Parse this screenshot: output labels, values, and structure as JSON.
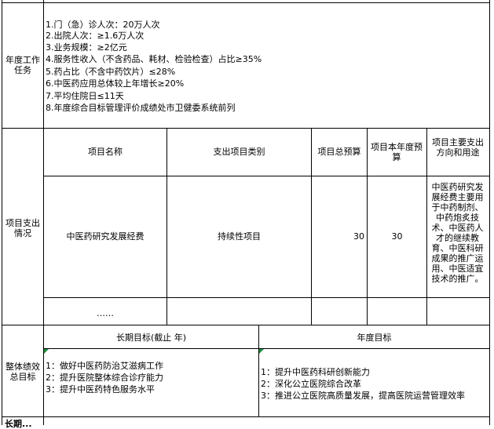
{
  "annual_task": {
    "label": "年度工作任务",
    "items": [
      "1.门（急）诊人次：20万人次",
      "2.出院人次：≥1.6万人次",
      "3.业务规模：≥2亿元",
      "4.服务性收入（不含药品、耗材、检验检查）占比≥35%",
      "5.药占比（不含中药饮片）≤28%",
      "6.中医药应用总体较上年增长≥20%",
      "7.平均住院日≤11天",
      "8.年度综合目标管理评价成绩处市卫健委系统前列"
    ]
  },
  "project_expense": {
    "label": "项目支出情况",
    "headers": {
      "name": "项目名称",
      "category": "支出项目类别",
      "total_budget": "项目总预算",
      "year_budget": "项目本年度预算",
      "purpose": "项目主要支出方向和用途"
    },
    "row": {
      "name": "中医药研究发展经费",
      "category": "持续性项目",
      "total_budget": "30",
      "year_budget": "30",
      "purpose": "中医药研究发展经费主要用于中药制剂、中药炮炙技术、中医药人才的继续教育、中医科研成果的推广运用、中医适宜技术的推广。"
    },
    "ellipsis": "……"
  },
  "performance": {
    "label": "整体绩效总目标",
    "long_term_header": "长期目标(截止     年)",
    "annual_header": "年度目标",
    "long_term_items": [
      "1：做好中医药防治艾滋病工作",
      "2：提升医院整体综合诊疗能力",
      "3：提升中医药特色服务水平"
    ],
    "annual_items": [
      "1：提升中医药科研创新能力",
      "2：深化公立医院综合改革",
      "3：推进公立医院高质量发展，提高医院运营管理效率"
    ]
  },
  "bottom_partial": "长期..."
}
